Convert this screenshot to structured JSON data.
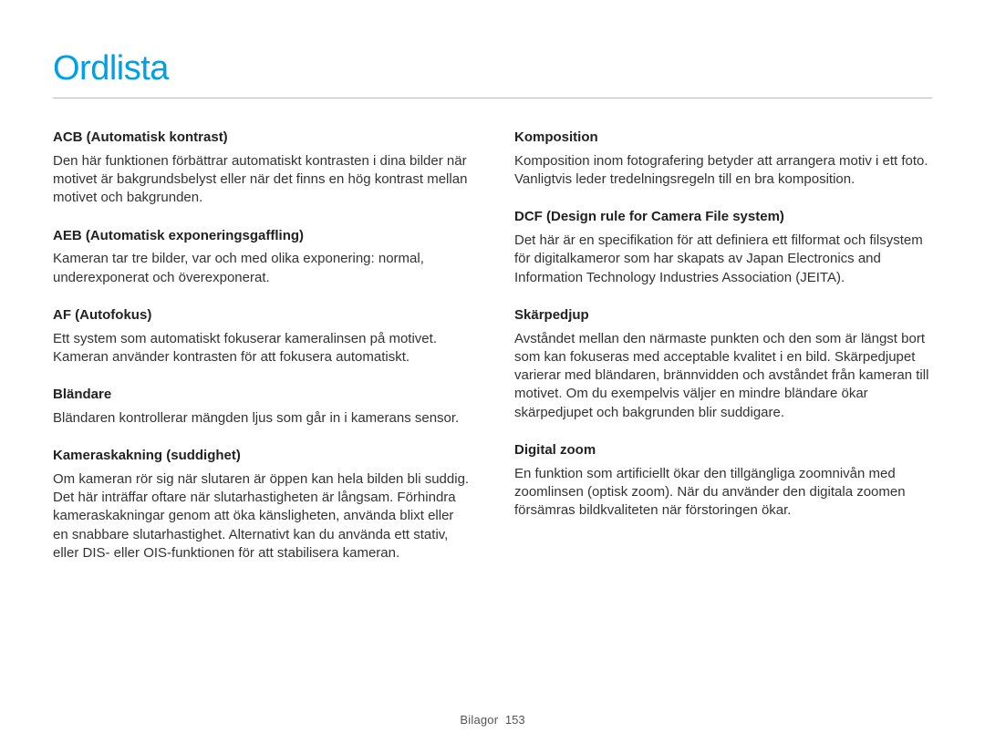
{
  "title": "Ordlista",
  "left": [
    {
      "term": "ACB (Automatisk kontrast)",
      "def": "Den här funktionen förbättrar automatiskt kontrasten i dina bilder när motivet är bakgrundsbelyst eller när det finns en hög kontrast mellan motivet och bakgrunden."
    },
    {
      "term": "AEB (Automatisk exponeringsgaffling)",
      "def": "Kameran tar tre bilder, var och med olika exponering: normal, underexponerat och överexponerat."
    },
    {
      "term": "AF (Autofokus)",
      "def": "Ett system som automatiskt fokuserar kameralinsen på motivet. Kameran använder kontrasten för att fokusera automatiskt."
    },
    {
      "term": "Bländare",
      "def": "Bländaren kontrollerar mängden ljus som går in i kamerans sensor."
    },
    {
      "term": "Kameraskakning (suddighet)",
      "def": "Om kameran rör sig när slutaren är öppen kan hela bilden bli suddig. Det här inträffar oftare när slutarhastigheten är långsam. Förhindra kameraskakningar genom att öka känsligheten, använda blixt eller en snabbare slutarhastighet. Alternativt kan du använda ett stativ, eller DIS- eller OIS-funktionen för att stabilisera kameran."
    }
  ],
  "right": [
    {
      "term": "Komposition",
      "def": "Komposition inom fotografering betyder att arrangera motiv i ett foto. Vanligtvis leder tredelningsregeln till en bra komposition."
    },
    {
      "term": "DCF (Design rule for Camera File system)",
      "def": "Det här är en specifikation för att definiera ett filformat och filsystem för digitalkameror som har skapats av Japan Electronics and Information Technology Industries Association (JEITA)."
    },
    {
      "term": "Skärpedjup",
      "def": "Avståndet mellan den närmaste punkten och den som är längst bort som kan fokuseras med acceptable kvalitet i en bild. Skärpedjupet varierar med bländaren, brännvidden och avståndet från kameran till motivet. Om du exempelvis väljer en mindre bländare ökar skärpedjupet och bakgrunden blir suddigare."
    },
    {
      "term": "Digital zoom",
      "def": "En funktion som artificiellt ökar den tillgängliga zoomnivån med zoomlinsen (optisk zoom). När du använder den digitala zoomen försämras bildkvaliteten när förstoringen ökar."
    }
  ],
  "footer": {
    "section": "Bilagor",
    "page": "153"
  }
}
